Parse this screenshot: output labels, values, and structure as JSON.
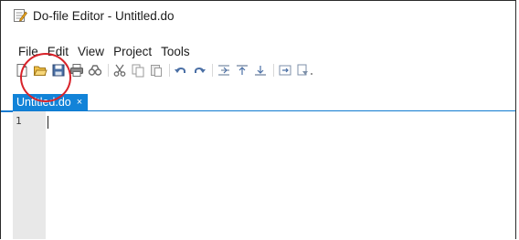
{
  "window": {
    "title": "Do-file Editor - Untitled.do",
    "app_icon": "do-file-editor-icon"
  },
  "menubar": {
    "items": [
      {
        "label": "File"
      },
      {
        "label": "Edit"
      },
      {
        "label": "View"
      },
      {
        "label": "Project"
      },
      {
        "label": "Tools"
      }
    ]
  },
  "toolbar": {
    "buttons": [
      {
        "icon": "new-file-icon"
      },
      {
        "icon": "open-folder-icon"
      },
      {
        "icon": "save-icon"
      },
      {
        "icon": "print-icon"
      },
      {
        "icon": "find-icon"
      },
      {
        "icon": "cut-icon"
      },
      {
        "icon": "copy-icon"
      },
      {
        "icon": "paste-icon"
      },
      {
        "icon": "undo-icon"
      },
      {
        "icon": "redo-icon"
      },
      {
        "icon": "indent-icon"
      },
      {
        "icon": "outdent-icon"
      },
      {
        "icon": "align-icon"
      },
      {
        "icon": "execute-icon"
      },
      {
        "icon": "run-dropdown-icon"
      }
    ]
  },
  "tabs": [
    {
      "label": "Untitled.do",
      "close": "×",
      "active": true
    }
  ],
  "editor": {
    "line_numbers": [
      "1"
    ]
  },
  "colors": {
    "tab_active": "#1283d8",
    "highlight": "#d8232a"
  }
}
